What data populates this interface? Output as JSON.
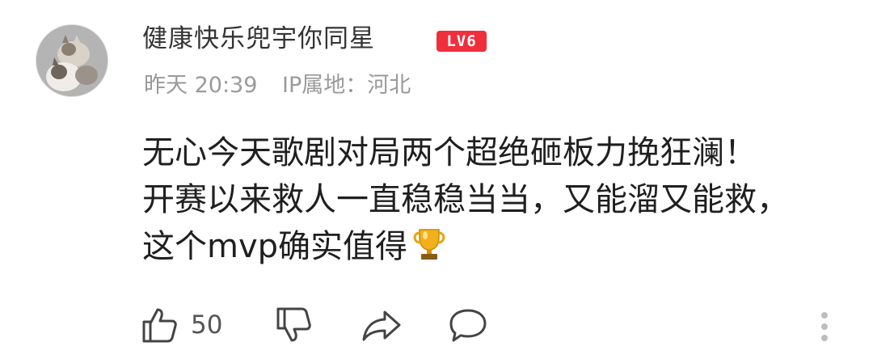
{
  "comment": {
    "username": "健康快乐兜宇你同星",
    "level_badge": "LV6",
    "time": "昨天 20:39",
    "ip_location": "IP属地：河北",
    "text_lines": [
      "无心今天歌剧对局两个超绝砸板力挽狂澜！",
      "开赛以来救人一直稳稳当当，又能溜又能救，",
      "这个mvp确实值得"
    ],
    "trophy_icon": "trophy-emoji",
    "like_count": "50"
  },
  "icons": {
    "like": "thumbs-up-icon",
    "dislike": "thumbs-down-icon",
    "share": "share-arrow-icon",
    "reply": "speech-bubble-icon",
    "more": "vertical-dots-icon"
  },
  "colors": {
    "badge_bg": "#ef2f3c",
    "meta_text": "#9a9a9a",
    "icon_stroke": "#444444"
  }
}
